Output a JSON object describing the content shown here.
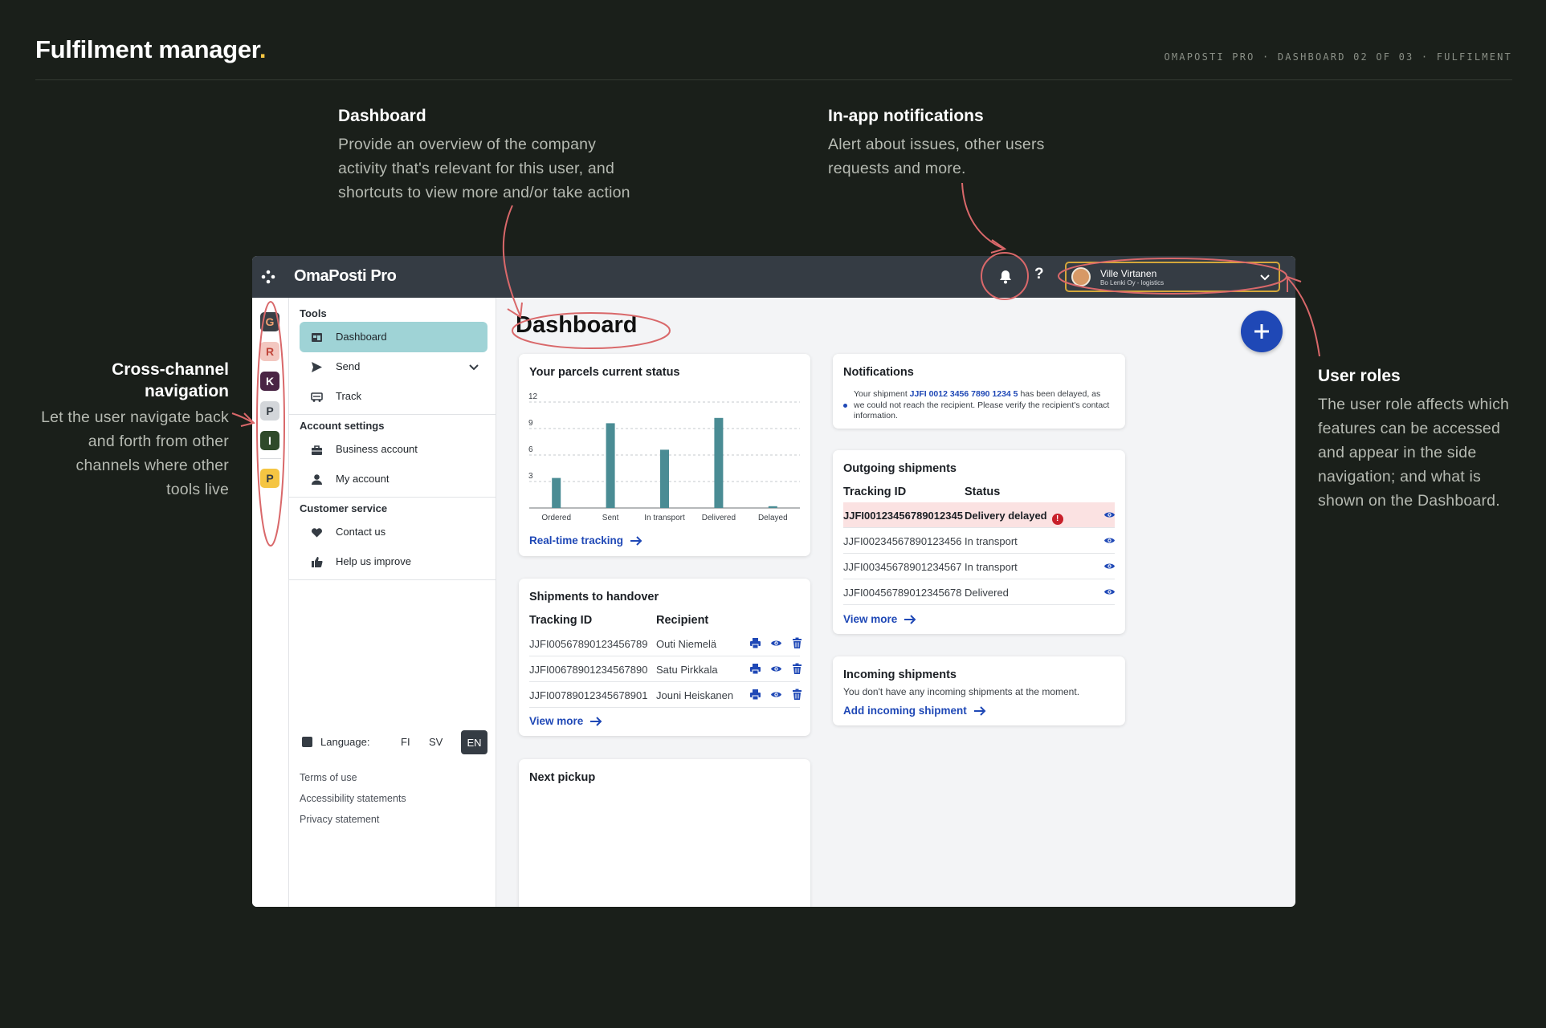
{
  "page": {
    "title": "Fulfilment manager",
    "title_dot": ".",
    "meta": "OMAPOSTI PRO · DASHBOARD 02 OF 03 · FULFILMENT"
  },
  "notes": {
    "dashboard": {
      "title": "Dashboard",
      "body": "Provide an overview of the company activity that's relevant for this user, and shortcuts to view more and/or take action"
    },
    "notifications": {
      "title": "In-app notifications",
      "body": "Alert about issues, other users requests and more."
    },
    "cross_channel": {
      "title": "Cross-channel navigation",
      "body": "Let the user navigate back and forth from other channels where other tools live"
    },
    "user_roles": {
      "title": "User roles",
      "body": "The user role affects which features can be accessed and appear in the side navigation; and what is shown on the Dashboard."
    }
  },
  "app": {
    "brand": "OmaPosti Pro",
    "help": "?",
    "user": {
      "name": "Ville Virtanen",
      "org": "Bo Lenki Oy - logistics"
    },
    "channels": [
      {
        "letter": "G",
        "bg": "#3a3f45",
        "fg": "#f0a070"
      },
      {
        "letter": "R",
        "bg": "#f3c7c0",
        "fg": "#c0453a"
      },
      {
        "letter": "K",
        "bg": "#4a2545",
        "fg": "#ffffff"
      },
      {
        "letter": "P",
        "bg": "#d3d6da",
        "fg": "#353c44"
      },
      {
        "letter": "I",
        "bg": "#2f4a2a",
        "fg": "#ffffff"
      },
      {
        "letter": "P",
        "bg": "#f5c542",
        "fg": "#353c44"
      }
    ],
    "sidebar": {
      "tools_title": "Tools",
      "tools": [
        {
          "label": "Dashboard",
          "icon": "dashboard-icon"
        },
        {
          "label": "Send",
          "icon": "send-icon"
        },
        {
          "label": "Track",
          "icon": "truck-icon"
        }
      ],
      "account_title": "Account settings",
      "account": [
        {
          "label": "Business account",
          "icon": "briefcase-icon"
        },
        {
          "label": "My account",
          "icon": "person-icon"
        }
      ],
      "service_title": "Customer service",
      "service": [
        {
          "label": "Contact us",
          "icon": "heart-icon"
        },
        {
          "label": "Help us improve",
          "icon": "thumbs-up-icon"
        }
      ],
      "language_label": "Language:",
      "languages": [
        "FI",
        "SV",
        "EN"
      ],
      "language_selected": "EN",
      "footer": [
        "Terms of use",
        "Accessibility statements",
        "Privacy statement"
      ]
    },
    "main": {
      "title": "Dashboard",
      "status_card": {
        "title": "Your parcels current status",
        "link": "Real-time tracking"
      },
      "handover": {
        "title": "Shipments to handover",
        "headers": [
          "Tracking ID",
          "Recipient"
        ],
        "rows": [
          {
            "id": "JJFI00567890123456789",
            "recipient": "Outi Niemelä"
          },
          {
            "id": "JJFI00678901234567890",
            "recipient": "Satu Pirkkala"
          },
          {
            "id": "JJFI00789012345678901",
            "recipient": "Jouni Heiskanen"
          }
        ],
        "link": "View more"
      },
      "next_pickup": {
        "title": "Next pickup"
      },
      "notifications": {
        "title": "Notifications",
        "text_before": "Your shipment ",
        "shipment_id": "JJFI 0012 3456 7890 1234 5",
        "text_after": " has been delayed, as we could not reach the recipient. Please verify the recipient's contact information."
      },
      "outgoing": {
        "title": "Outgoing shipments",
        "headers": [
          "Tracking ID",
          "Status"
        ],
        "rows": [
          {
            "id": "JJFI00123456789012345",
            "status": "Delivery delayed",
            "alert": true
          },
          {
            "id": "JJFI00234567890123456",
            "status": "In transport",
            "alert": false
          },
          {
            "id": "JJFI00345678901234567",
            "status": "In transport",
            "alert": false
          },
          {
            "id": "JJFI00456789012345678",
            "status": "Delivered",
            "alert": false
          }
        ],
        "link": "View more"
      },
      "incoming": {
        "title": "Incoming shipments",
        "text": "You don't have any incoming shipments at the moment.",
        "link": "Add incoming shipment"
      }
    }
  },
  "chart_data": {
    "type": "bar",
    "categories": [
      "Ordered",
      "Sent",
      "In transport",
      "Delivered",
      "Delayed"
    ],
    "values": [
      3.4,
      9.6,
      6.6,
      10.2,
      0.2
    ],
    "ylim": [
      0,
      12
    ],
    "yticks": [
      3,
      6,
      9,
      12
    ],
    "grid": true,
    "bar_color": "#4a8c94"
  }
}
